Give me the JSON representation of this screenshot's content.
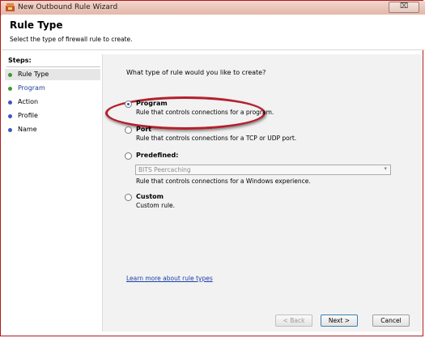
{
  "window": {
    "title": "New Outbound Rule Wizard",
    "close_glyph": "⌧"
  },
  "header": {
    "title": "Rule Type",
    "subtitle": "Select the type of firewall rule to create."
  },
  "sidebar": {
    "steps_label": "Steps:",
    "items": [
      {
        "label": "Rule Type",
        "color": "#3c9a2c"
      },
      {
        "label": "Program",
        "color": "#3c9a2c"
      },
      {
        "label": "Action",
        "color": "#3c57c4"
      },
      {
        "label": "Profile",
        "color": "#3c57c4"
      },
      {
        "label": "Name",
        "color": "#3c57c4"
      }
    ]
  },
  "main": {
    "question": "What type of rule would you like to create?",
    "options": [
      {
        "title": "Program",
        "desc": "Rule that controls connections for a program.",
        "selected": true
      },
      {
        "title": "Port",
        "desc": "Rule that controls connections for a TCP or UDP port.",
        "selected": false
      },
      {
        "title": "Predefined:",
        "desc": "Rule that controls connections for a Windows experience.",
        "selected": false
      },
      {
        "title": "Custom",
        "desc": "Custom rule.",
        "selected": false
      }
    ],
    "predefined_select": "BITS Peercaching",
    "learn_link": "Learn more about rule types"
  },
  "buttons": {
    "back": "< Back",
    "next": "Next >",
    "cancel": "Cancel"
  }
}
